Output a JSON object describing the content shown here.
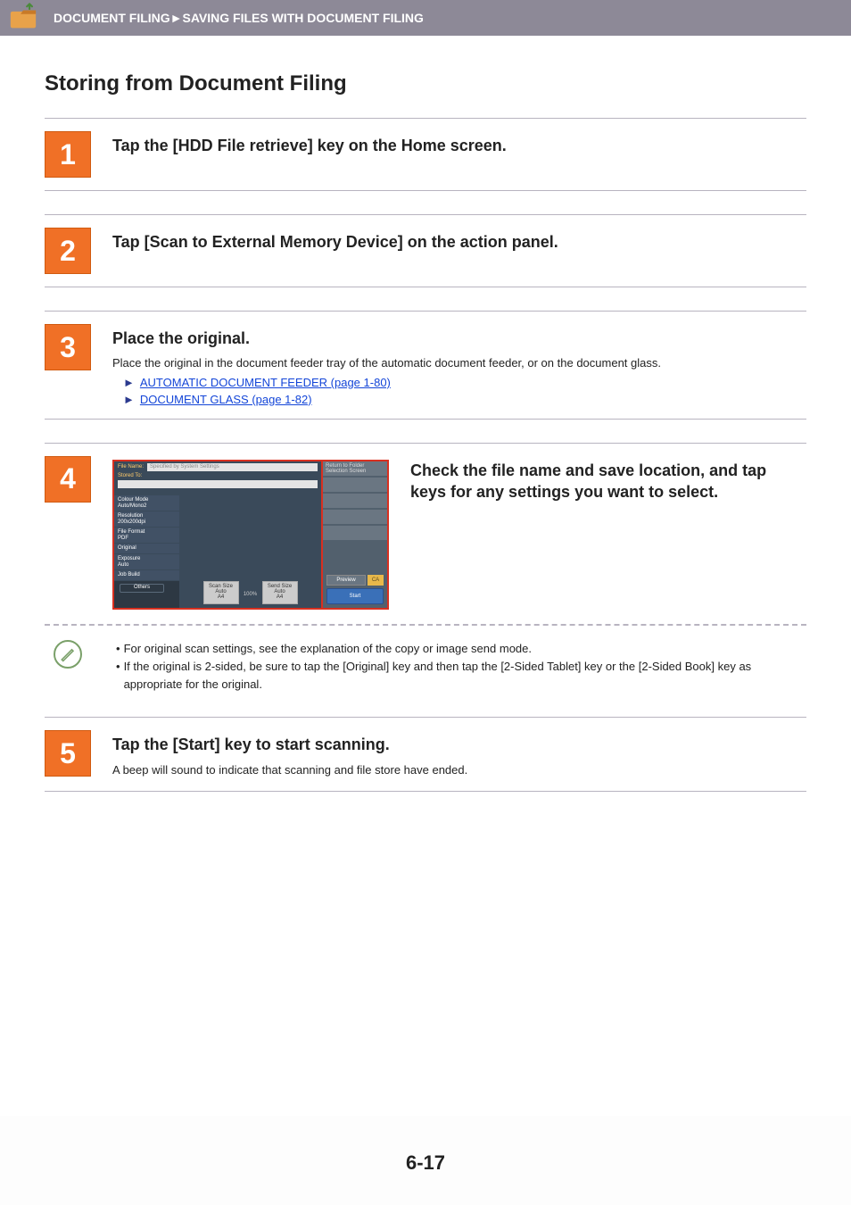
{
  "header": {
    "breadcrumb": "DOCUMENT FILING►SAVING FILES WITH DOCUMENT FILING"
  },
  "title": "Storing from Document Filing",
  "steps": {
    "s1": {
      "num": "1",
      "title": "Tap the [HDD File retrieve] key on the Home screen."
    },
    "s2": {
      "num": "2",
      "title": "Tap [Scan to External Memory Device] on the action panel."
    },
    "s3": {
      "num": "3",
      "title": "Place the original.",
      "body": "Place the original in the document feeder tray of the automatic document feeder, or on the document glass.",
      "link1": "AUTOMATIC DOCUMENT FEEDER (page 1-80)",
      "link2": "DOCUMENT GLASS (page 1-82)"
    },
    "s4": {
      "num": "4",
      "title": "Check the file name and save location, and tap keys for any settings you want to select.",
      "ss": {
        "file_name_label": "File Name:",
        "file_name_value": "Specified by System Settings",
        "stored_to_label": "Stored To:",
        "left": {
          "colour_mode": {
            "label": "Colour Mode",
            "value": "Auto/Mono2"
          },
          "resolution": {
            "label": "Resolution",
            "value": "200x200dpi"
          },
          "file_format": {
            "label": "File Format",
            "value": "PDF"
          },
          "original": "Original",
          "exposure": {
            "label": "Exposure",
            "value": "Auto"
          },
          "job_build": "Job Build",
          "others": "Others"
        },
        "center": {
          "scan_size": {
            "label": "Scan Size",
            "value": "Auto",
            "paper": "A4"
          },
          "zoom": "100%",
          "send_size": {
            "label": "Send Size",
            "value": "Auto",
            "paper": "A4"
          }
        },
        "right": {
          "return": "Return to Folder Selection Screen",
          "preview": "Preview",
          "ca": "CA",
          "start": "Start"
        }
      },
      "notes": {
        "n1": "For original scan settings, see the explanation of the copy or image send mode.",
        "n2": "If the original is 2-sided, be sure to tap the [Original] key and then tap the [2-Sided Tablet] key or the [2-Sided Book] key as appropriate for the original."
      }
    },
    "s5": {
      "num": "5",
      "title": "Tap the [Start] key to start scanning.",
      "body": "A beep will sound to indicate that scanning and file store have ended."
    }
  },
  "page_number": "6-17",
  "chev": "►"
}
